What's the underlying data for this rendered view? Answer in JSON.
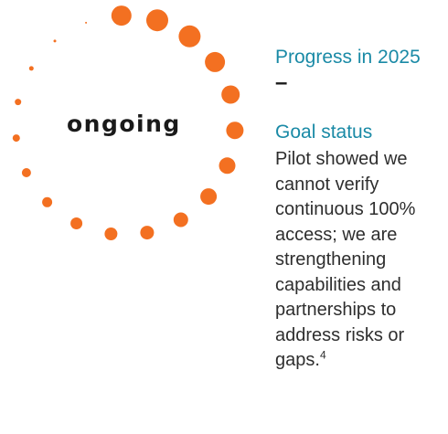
{
  "status": {
    "label": "ongoing",
    "dot_color": "#f37021",
    "dots_filled": 12,
    "dots_total": 24
  },
  "progress": {
    "heading": "Progress in 2025",
    "value": "–"
  },
  "goal": {
    "heading": "Goal status",
    "text": "Pilot showed we cannot verify continuous 100% access; we are strengthening capabilities and partnerships to address risks or gaps.",
    "footnote": "4"
  }
}
